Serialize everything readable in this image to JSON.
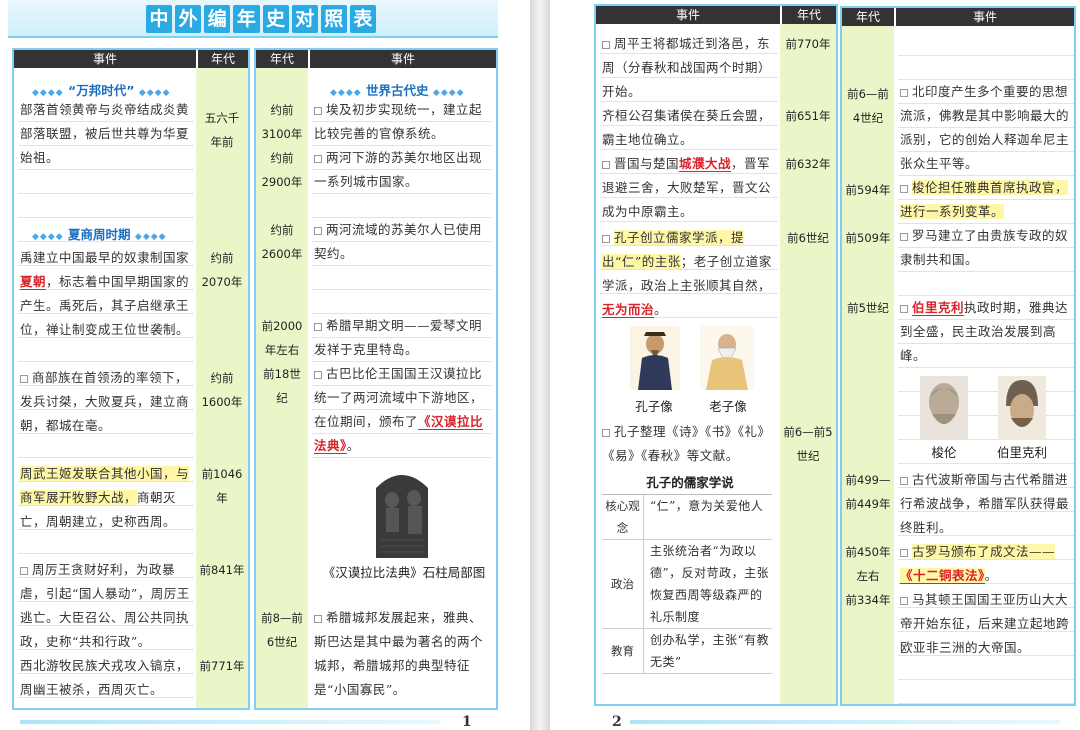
{
  "book": {
    "title": "中外编年史对照表"
  },
  "headers": {
    "event": "事件",
    "era": "年代"
  },
  "left_page": {
    "section_wanbang": "“万邦时代”",
    "section_xiashang": "夏商周时期",
    "section_world": "世界古代史",
    "events": [
      {
        "pre": "部落首领黄帝与炎帝结成炎黄部落联盟，被后世共尊为华夏始祖。",
        "era": "五六千年前"
      },
      {
        "pre": "禹建立中国最早的奴隶制国家",
        "red": "夏朝",
        "post": "，标志着中国早期国家的产生。禹死后，其子启继承王位，禅让制变成王位世袭制。",
        "era": "约前2070年"
      },
      {
        "pre": "商部族在首领汤的率领下，发兵讨桀，大败夏兵，建立商朝，都城在亳。",
        "era": "约前1600年"
      },
      {
        "pre": "周武王姬发联合其他小国，与商军展开牧野大战，",
        "post": "商朝灭亡，周朝建立，史称西周。",
        "era": "前1046年"
      },
      {
        "pre": "周厉王贪财好利，为政暴虐，引起“国人暴动”，周厉王逃亡。大臣召公、周公共同执政，史称“共和行政”。",
        "era": "前841年"
      },
      {
        "pre": "西北游牧民族犬戎攻入镐京，周幽王被杀，西周灭亡。",
        "era": "前771年"
      }
    ],
    "world_events": [
      {
        "pre": "埃及初步实现统一，建立起比较完善的官僚系统。",
        "era": "约前3100年"
      },
      {
        "pre": "两河下游的苏美尔地区出现一系列城市国家。",
        "era": "约前2900年"
      },
      {
        "pre": "两河流域的苏美尔人已使用契约。",
        "era": "约前2600年"
      },
      {
        "pre": "希腊早期文明——爱琴文明发祥于克里特岛。",
        "era": "前2000年左右"
      },
      {
        "pre": "古巴比伦王国国王汉谟拉比统一了两河流域中下游地区，在位期间，颁布了",
        "red": "《汉谟拉比法典》",
        "post": "。",
        "era": "前18世纪"
      },
      {
        "pre": "希腊城邦发展起来，雅典、斯巴达是其中最为著名的两个城邦，希腊城邦的典型特征是“小国寡民”。",
        "era": "前8—前6世纪"
      }
    ],
    "caption_hammurabi": "《汉谟拉比法典》石柱局部图",
    "page_number": "1"
  },
  "right_page": {
    "events": [
      {
        "pre": "周平王将都城迁到洛邑，东周（分春秋和战国两个时期）开始。",
        "era": "前770年"
      },
      {
        "pre": "齐桓公召集诸侯在葵丘会盟，霸主地位确立。",
        "era": "前651年"
      },
      {
        "pre": "晋国与楚国",
        "red": "城濮大战",
        "post": "，晋军退避三舍，大败楚军，晋文公成为中原霸主。",
        "era": "前632年"
      },
      {
        "pre": "孔子创立儒家学派，提出“仁”的主张",
        "post": "；老子创立道家学派，政治上主张顺其自然，",
        "red": "无为而治",
        "tail": "。",
        "era": "前6世纪"
      },
      {
        "pre": "孔子整理《诗》《书》《礼》《易》《春秋》等文献。",
        "era": "前6—前5世纪"
      }
    ],
    "caption_kongzi": "孔子像",
    "caption_laozi": "老子像",
    "confucian_title": "孔子的儒家学说",
    "confucian_rows": [
      {
        "key": "核心观念",
        "value": "“仁”，意为关爱他人"
      },
      {
        "key": "政治",
        "value": "主张统治者“为政以德”，反对苛政，主张恢复西周等级森严的礼乐制度"
      },
      {
        "key": "教育",
        "value": "创办私学，主张“有教无类”"
      }
    ],
    "world_events": [
      {
        "pre": "北印度产生多个重要的思想流派，佛教是其中影响最大的派别，它的创始人释迦牟尼主张众生平等。",
        "era": "前6—前4世纪"
      },
      {
        "pre": "梭伦担任雅典首席执政官，进行一系列变革。",
        "era": "前594年"
      },
      {
        "pre": "罗马建立了由贵族专政的奴隶制共和国。",
        "era": "前509年"
      },
      {
        "red": "伯里克利",
        "post": "执政时期，雅典达到全盛，民主政治发展到高峰。",
        "era": "前5世纪"
      },
      {
        "pre": "古代波斯帝国与古代希腊进行希波战争，希腊军队获得最终胜利。",
        "era": "前499—前449年"
      },
      {
        "pre": "古罗马颁布了成文法——",
        "red": "《十二铜表法》",
        "post": "。",
        "era": "前450年左右"
      },
      {
        "pre": "马其顿王国国王亚历山大大帝开始东征，后来建立起地跨欧亚非三洲的大帝国。",
        "era": "前334年"
      }
    ],
    "caption_solon": "梭伦",
    "caption_pericles": "伯里克利",
    "page_number": "2"
  },
  "colors": {
    "accent": "#2aa9e3",
    "highlight": "#fff7a8",
    "era_column": "#eaf6c8",
    "key_term": "#d8242a"
  }
}
